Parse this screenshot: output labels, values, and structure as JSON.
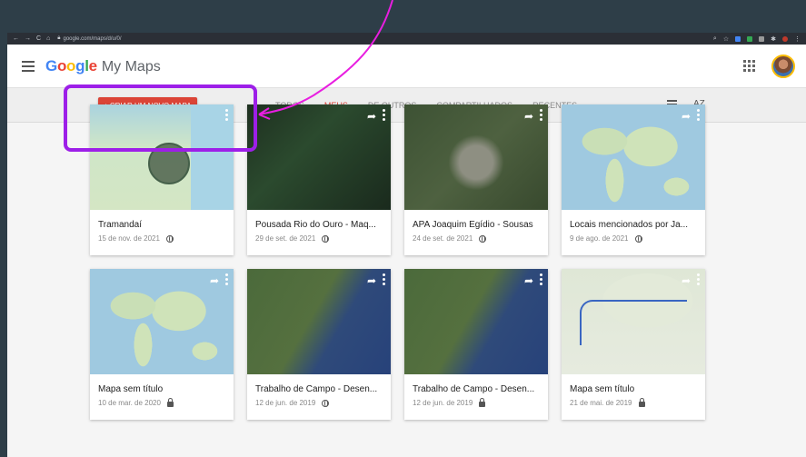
{
  "browser": {
    "url": "google.com/maps/d/u/0/",
    "nav_icons": [
      "back-icon",
      "forward-icon",
      "reload-icon",
      "home-icon"
    ],
    "extension_colors": [
      "#4285f4",
      "#34a853",
      "#999999"
    ]
  },
  "appbar": {
    "logo_google": "Google",
    "logo_product": "My Maps",
    "google_colors": [
      "#4285f4",
      "#ea4335",
      "#fbbc04",
      "#4285f4",
      "#34a853",
      "#ea4335"
    ]
  },
  "toolbar": {
    "create_label": "+ CRIAR UM NOVO MAPA",
    "tabs": [
      {
        "label": "TODOS",
        "active": false
      },
      {
        "label": "MEUS",
        "active": true
      },
      {
        "label": "DE OUTROS",
        "active": false
      },
      {
        "label": "COMPARTILHADOS",
        "active": false
      },
      {
        "label": "RECENTES",
        "active": false
      }
    ],
    "sort_label": "AZ"
  },
  "maps": [
    {
      "title": "Tramandaí",
      "date": "15 de nov. de 2021",
      "visibility": "public",
      "thumb": "map-light"
    },
    {
      "title": "Pousada Rio do Ouro - Maq...",
      "date": "29 de set. de 2021",
      "visibility": "public",
      "thumb": "sat-forest"
    },
    {
      "title": "APA Joaquim Egídio - Sousas",
      "date": "24 de set. de 2021",
      "visibility": "public",
      "thumb": "sat-urban"
    },
    {
      "title": "Locais mencionados por Ja...",
      "date": "9 de ago. de 2021",
      "visibility": "public",
      "thumb": "map-world"
    },
    {
      "title": "Mapa sem título",
      "date": "10 de mar. de 2020",
      "visibility": "private",
      "thumb": "map-world"
    },
    {
      "title": "Trabalho de Campo - Desen...",
      "date": "12 de jun. de 2019",
      "visibility": "public",
      "thumb": "sat-coast"
    },
    {
      "title": "Trabalho de Campo - Desen...",
      "date": "12 de jun. de 2019",
      "visibility": "private",
      "thumb": "sat-coast"
    },
    {
      "title": "Mapa sem título",
      "date": "21 de mai. de 2019",
      "visibility": "private",
      "thumb": "map-route"
    }
  ],
  "annotation": {
    "color": "#9d1fe8",
    "arrow_color": "#e81ee0"
  }
}
